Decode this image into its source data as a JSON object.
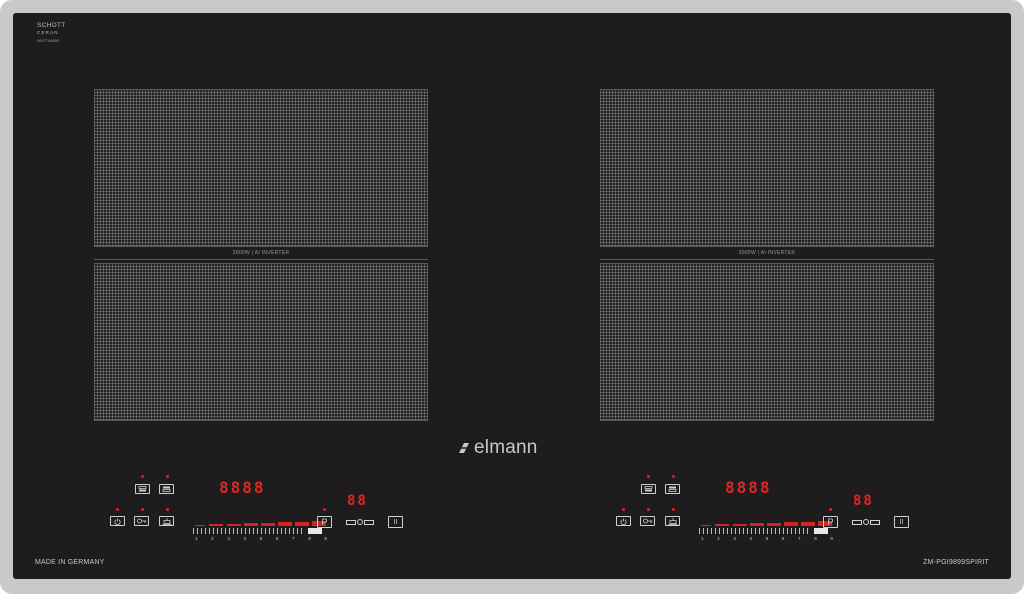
{
  "brand_small": {
    "line1": "SCHOTT",
    "line2": "CERAN",
    "line3": "0697766899"
  },
  "zones": {
    "label": "3000W | AI INVERTER"
  },
  "logo": {
    "text": "elmann"
  },
  "footer": {
    "left": "MADE IN GERMANY",
    "right": "ZM-PGI9899SPIRIT"
  },
  "panel": {
    "main_display": "8888",
    "timer_display": "88",
    "power_scale": [
      "1",
      "2",
      "3",
      "4",
      "5",
      "6",
      "7",
      "8",
      "9"
    ],
    "boost_label": "P",
    "pause_label": "II"
  },
  "colors": {
    "led_red": "#e22422",
    "glass": "#1e1c1d",
    "frame": "#c8c9cb"
  }
}
